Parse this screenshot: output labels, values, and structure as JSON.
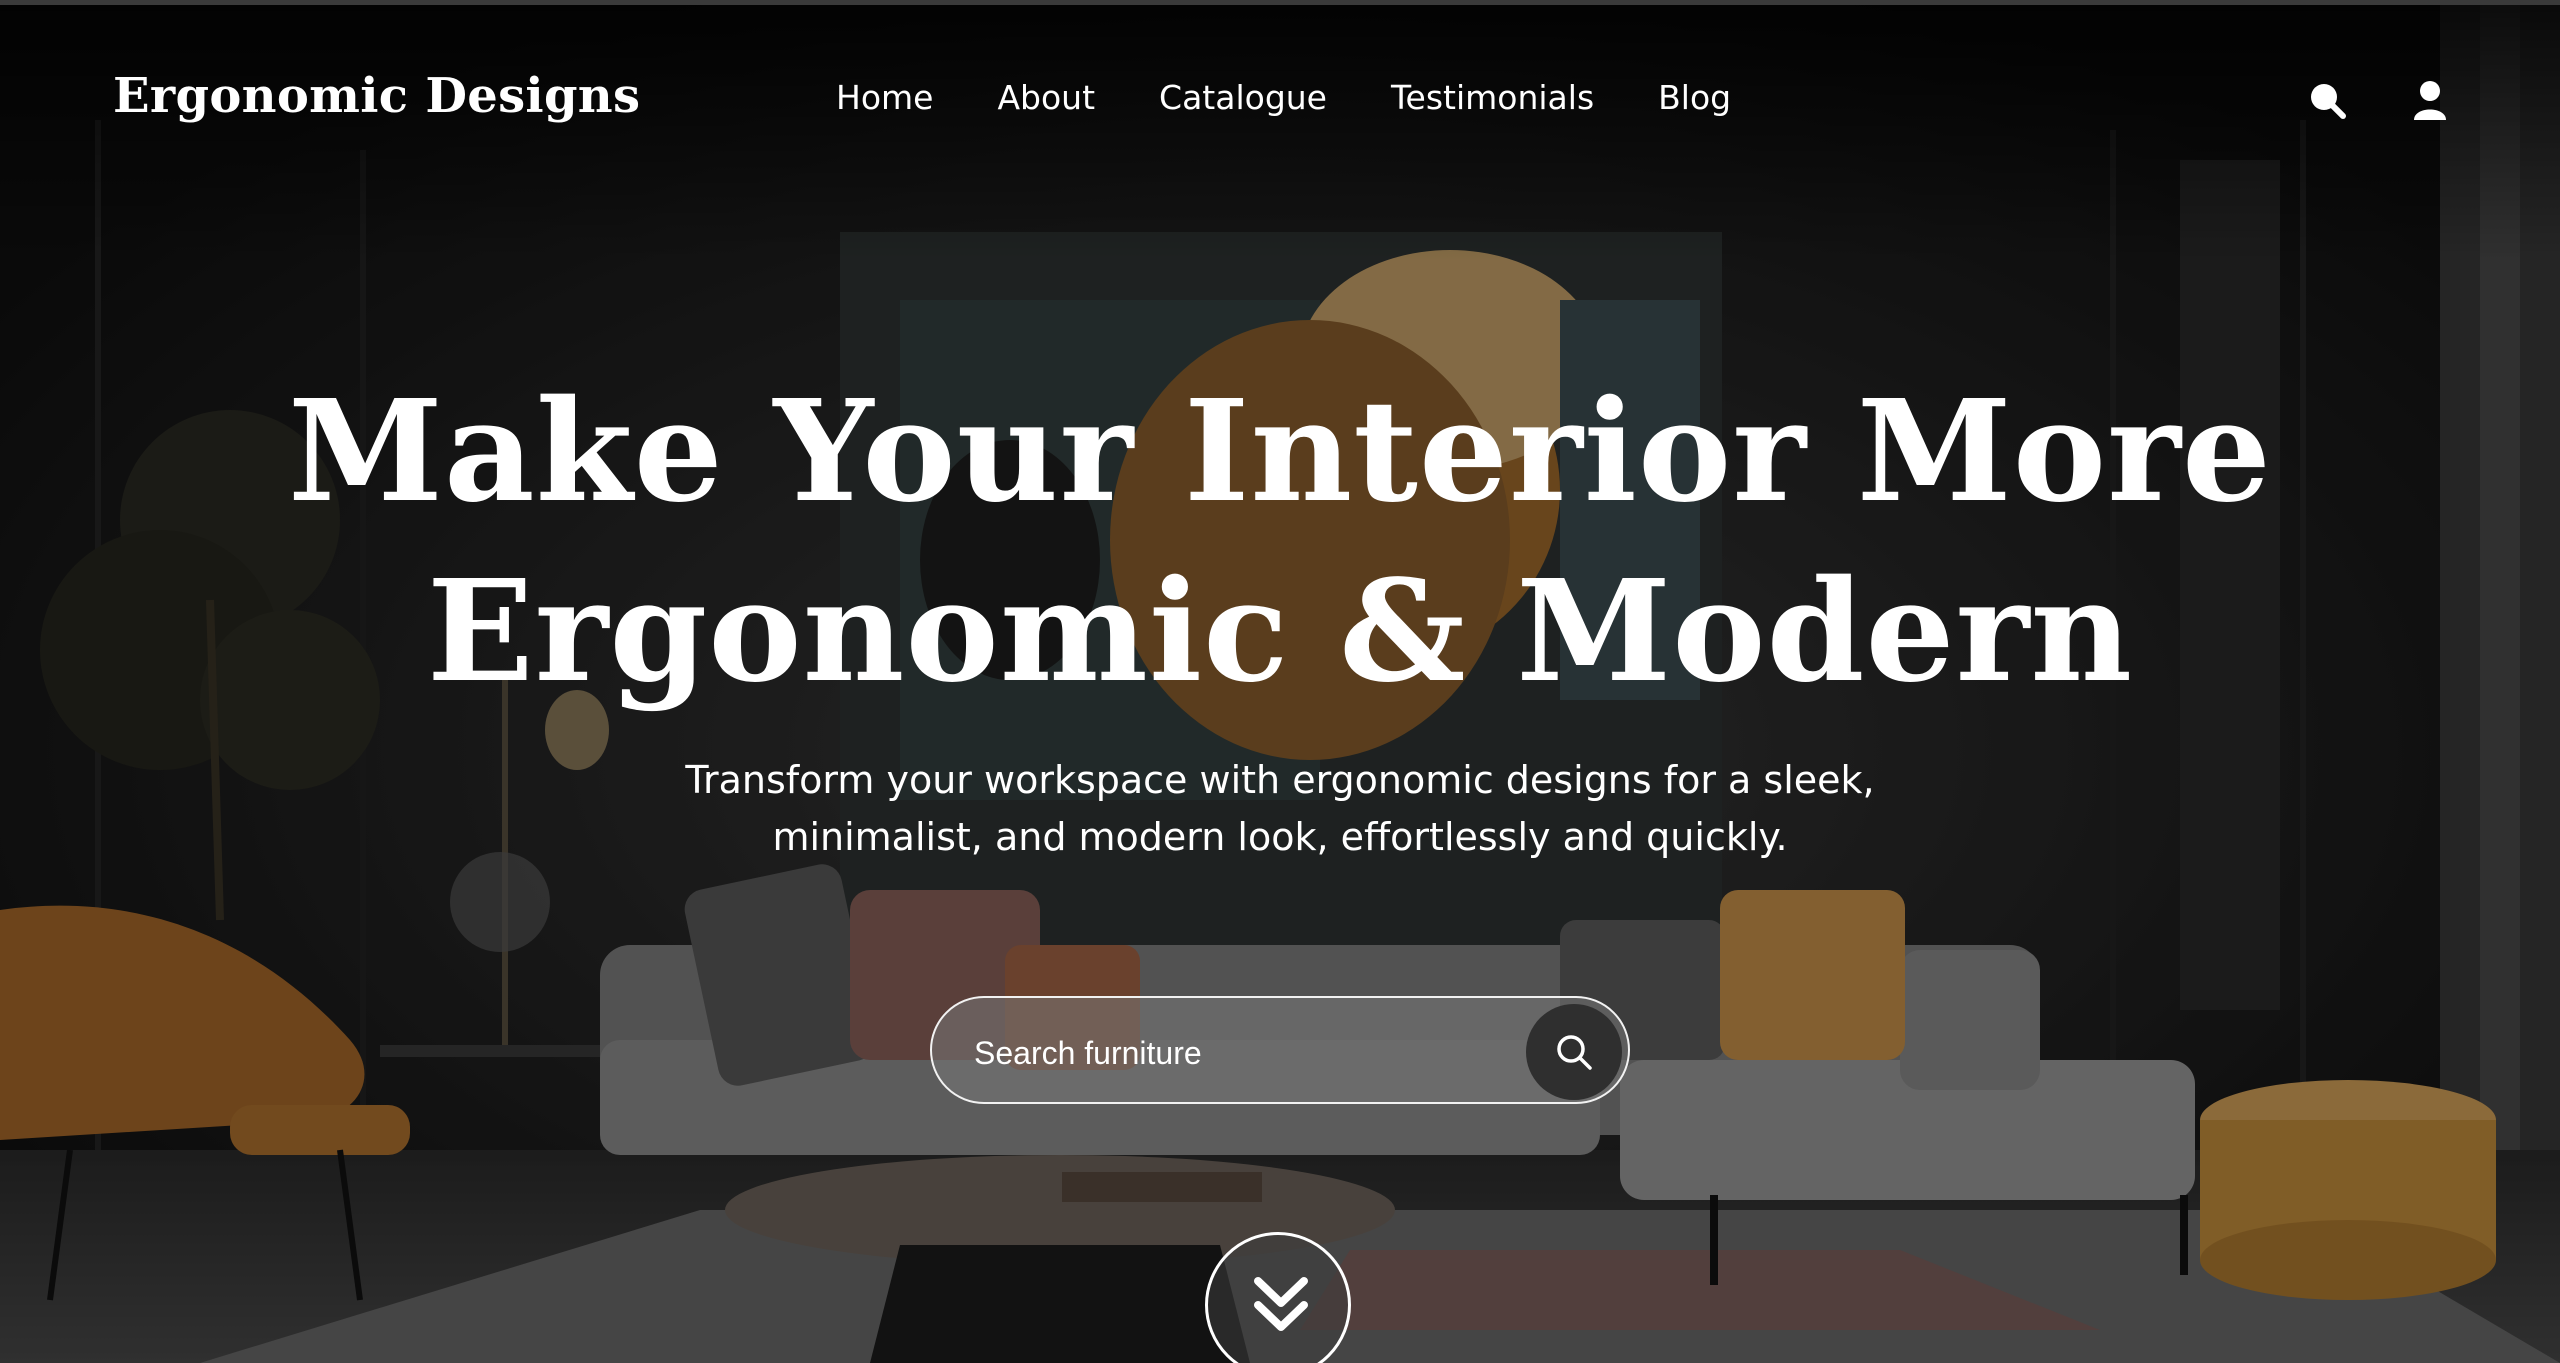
{
  "brand": {
    "name": "Ergonomic Designs"
  },
  "nav": {
    "items": [
      {
        "label": "Home"
      },
      {
        "label": "About"
      },
      {
        "label": "Catalogue"
      },
      {
        "label": "Testimonials"
      },
      {
        "label": "Blog"
      }
    ],
    "icons": [
      "search-icon",
      "user-icon"
    ]
  },
  "hero": {
    "headline_line1": "Make Your Interior More",
    "headline_line2": "Ergonomic & Modern",
    "subtitle_line1": "Transform your workspace with ergonomic designs for a sleek,",
    "subtitle_line2": "minimalist, and modern look, effortlessly and quickly."
  },
  "search": {
    "placeholder": "Search furniture",
    "value": ""
  },
  "scroll": {
    "icon": "double-chevron-down-icon"
  },
  "colors": {
    "text": "#ffffff",
    "overlay": "#161616",
    "search_button": "#2f2f2f",
    "pouf": "#c58f3c",
    "chair": "#a8692a",
    "sofa": "#8e8e8e"
  }
}
